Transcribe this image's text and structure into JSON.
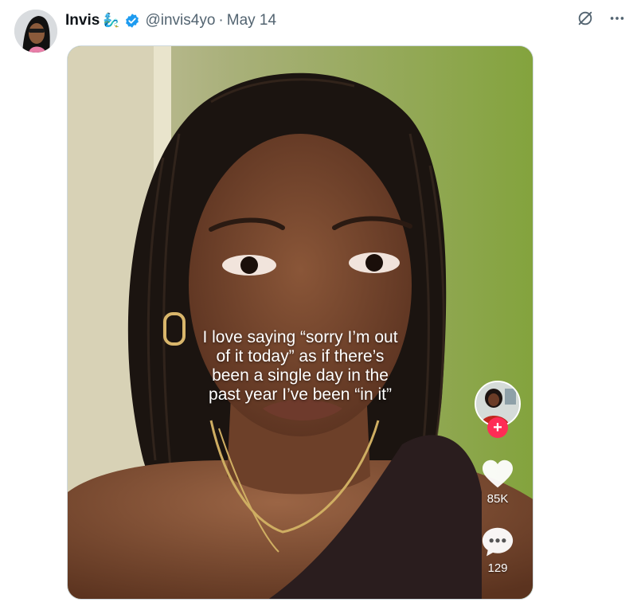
{
  "post": {
    "author_name": "Invis",
    "author_emoji": "🧞‍♂️",
    "handle": "@invis4yo",
    "separator": "·",
    "date": "May 14"
  },
  "video": {
    "caption_lines": [
      "I love saying “sorry I’m out",
      "of it today” as if there’s",
      "been a single day in the",
      "past year I’ve been “in it”"
    ],
    "likes": "85K",
    "comments": "129",
    "follow_symbol": "+"
  },
  "colors": {
    "verified": "#1d9bf0",
    "follow": "#fe2c55",
    "background_wall": "#8aa54a"
  },
  "icons": {
    "verified": "verified-badge-icon",
    "grok": "grok-icon",
    "more": "more-icon",
    "like": "heart-icon",
    "comment": "comment-icon"
  }
}
